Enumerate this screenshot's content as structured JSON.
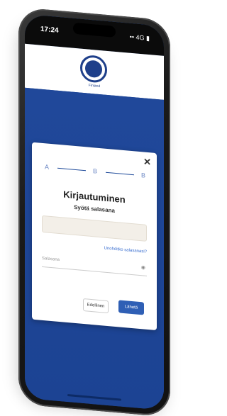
{
  "status": {
    "time": "17:24",
    "icons": "•• 4G ▮"
  },
  "header": {
    "crest_label": "Finland"
  },
  "modal": {
    "close": "✕",
    "steps": [
      "A",
      "B",
      "B"
    ],
    "title": "Kirjautuminen",
    "subtitle": "Syötä salasana",
    "input1_value": "",
    "forgot_link": "Unohditko salasanasi?",
    "password_placeholder": "Salasana",
    "eye": "◉",
    "cancel_label": "Edellinen",
    "next_label": "Lähetä"
  },
  "colors": {
    "brand_blue": "#1e4a9a",
    "button_blue": "#2f5fb5",
    "link_blue": "#3a6fd0"
  }
}
